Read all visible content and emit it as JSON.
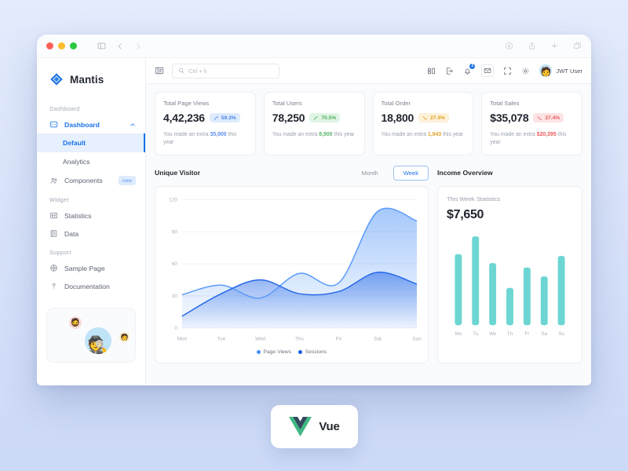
{
  "window": {
    "chrome": {
      "traffic_lights": [
        "close",
        "minimize",
        "maximize"
      ],
      "sidebar_toggle_icon": "sidebar-panel-icon",
      "back_icon": "chevron-left-icon",
      "forward_icon": "chevron-right-icon",
      "download_icon": "download-icon",
      "share_icon": "share-icon",
      "new_tab_icon": "plus-icon",
      "tabs_icon": "copy-tabs-icon"
    }
  },
  "sidebar": {
    "brand": {
      "name": "Mantis",
      "logo_icon": "diamond-logo-icon"
    },
    "sections": [
      {
        "caption": "Dashboard",
        "items": [
          {
            "label": "Dashboard",
            "icon": "dashboard-icon",
            "active": true,
            "expanded": true,
            "children": [
              {
                "label": "Default",
                "selected": true
              },
              {
                "label": "Analytics",
                "selected": false
              }
            ]
          },
          {
            "label": "Components",
            "icon": "components-icon",
            "chip": "new"
          }
        ]
      },
      {
        "caption": "Widget",
        "items": [
          {
            "label": "Statistics",
            "icon": "statistics-icon"
          },
          {
            "label": "Data",
            "icon": "data-icon"
          }
        ]
      },
      {
        "caption": "Support",
        "items": [
          {
            "label": "Sample Page",
            "icon": "sample-page-icon"
          },
          {
            "label": "Documentation",
            "icon": "question-mark-icon"
          }
        ]
      }
    ],
    "promo": {
      "avatar_icon": "person-hat-avatar",
      "bubble_1_icon": "small-avatar-pink",
      "bubble_2_icon": "small-avatar-yellow"
    }
  },
  "topbar": {
    "menu_icon": "menu-collapse-icon",
    "search": {
      "placeholder": "Ctrl + k",
      "icon": "search-icon",
      "value": ""
    },
    "icons": [
      {
        "name": "grid-apps-icon"
      },
      {
        "name": "export-icon"
      },
      {
        "name": "bell-icon",
        "badge": "2"
      },
      {
        "name": "mail-icon",
        "boxed": true
      },
      {
        "name": "fullscreen-icon"
      },
      {
        "name": "gear-icon"
      }
    ],
    "user": {
      "name": "JWT User",
      "avatar_icon": "user-avatar"
    }
  },
  "stats": [
    {
      "title": "Total Page Views",
      "value": "4,42,236",
      "pill": {
        "text": "59.3%",
        "trend": "up",
        "color": "blue"
      },
      "sub_prefix": "You made an extra ",
      "sub_highlight": "35,000",
      "sub_suffix": " this year",
      "highlight_color": "blue"
    },
    {
      "title": "Total Users",
      "value": "78,250",
      "pill": {
        "text": "70.5%",
        "trend": "up",
        "color": "green"
      },
      "sub_prefix": "You made an extra ",
      "sub_highlight": "8,900",
      "sub_suffix": " this year",
      "highlight_color": "green"
    },
    {
      "title": "Total Order",
      "value": "18,800",
      "pill": {
        "text": "27.4%",
        "trend": "down",
        "color": "orange"
      },
      "sub_prefix": "You made an extra ",
      "sub_highlight": "1,943",
      "sub_suffix": " this year",
      "highlight_color": "orange"
    },
    {
      "title": "Total Sales",
      "value": "$35,078",
      "pill": {
        "text": "27.4%",
        "trend": "down",
        "color": "red"
      },
      "sub_prefix": "You made an extra ",
      "sub_highlight": "$20,395",
      "sub_suffix": " this year",
      "highlight_color": "red"
    }
  ],
  "unique_visitor": {
    "title": "Unique Visitor",
    "toggle": {
      "month": "Month",
      "week": "Week",
      "selected": "Week"
    }
  },
  "income": {
    "title": "Income Overview",
    "subtitle": "This Week Statistics",
    "value": "$7,650"
  },
  "colors": {
    "accent": "#1a73ea",
    "page_views": "#5b9bf8",
    "sessions": "#2568e8",
    "bar_teal": "#6ed6d2",
    "background": "#dde7fb"
  },
  "vue_badge": {
    "text": "Vue",
    "logo_icon": "vue-logo-icon"
  },
  "chart_data": [
    {
      "type": "area",
      "title": "Unique Visitor",
      "categories": [
        "Mon",
        "Tue",
        "Wed",
        "Thu",
        "Fri",
        "Sat",
        "Sun"
      ],
      "series": [
        {
          "name": "Page Views",
          "values": [
            31,
            40,
            28,
            51,
            42,
            109,
            100
          ],
          "color": "#5b9bf8"
        },
        {
          "name": "Sessions",
          "values": [
            11,
            32,
            45,
            32,
            34,
            52,
            41
          ],
          "color": "#2568e8"
        }
      ],
      "ylim": [
        0,
        120
      ],
      "yticks": [
        0,
        30,
        60,
        90,
        120
      ],
      "xlabel": "",
      "ylabel": "",
      "grid": true,
      "legend_position": "bottom"
    },
    {
      "type": "bar",
      "title": "Income Overview",
      "categories": [
        "Mo",
        "Tu",
        "We",
        "Th",
        "Fr",
        "Sa",
        "Su"
      ],
      "values": [
        80,
        100,
        70,
        42,
        65,
        55,
        78
      ],
      "ylim": [
        0,
        110
      ],
      "xlabel": "",
      "ylabel": "",
      "grid": false,
      "color": "#6ed6d2"
    }
  ]
}
